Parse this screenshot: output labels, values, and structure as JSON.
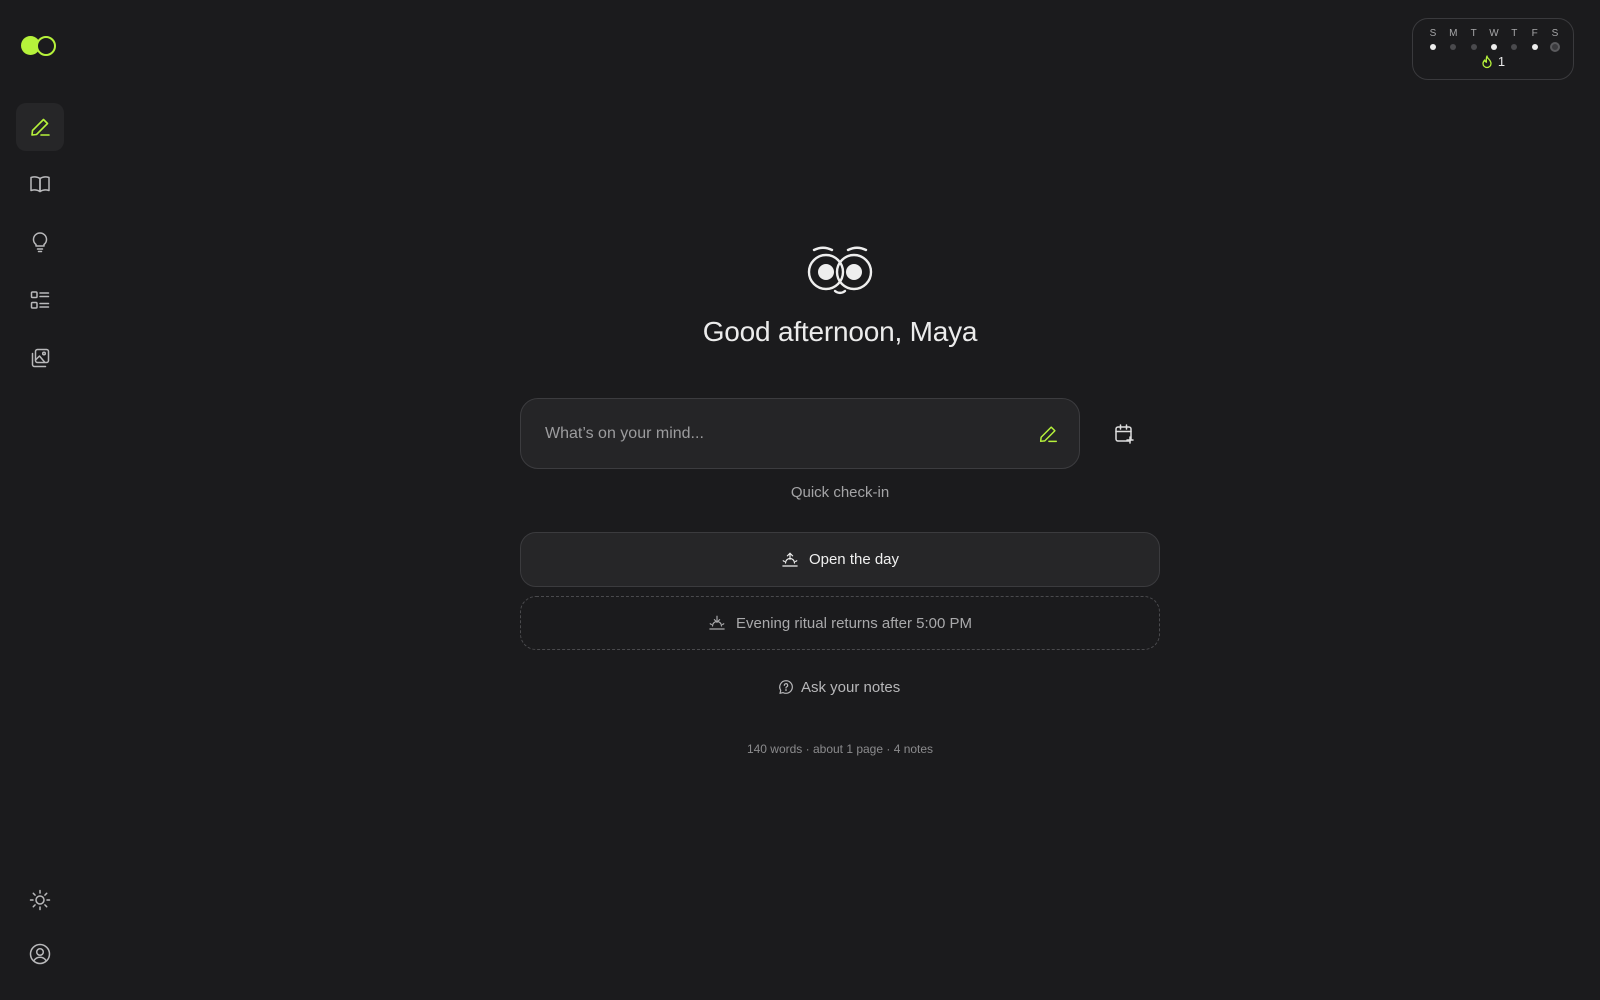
{
  "sidebar": {
    "items": [
      {
        "icon": "pencil-icon",
        "active": true
      },
      {
        "icon": "book-icon",
        "active": false
      },
      {
        "icon": "lightbulb-icon",
        "active": false
      },
      {
        "icon": "list-icon",
        "active": false
      },
      {
        "icon": "gallery-icon",
        "active": false
      }
    ],
    "bottom_items": [
      {
        "icon": "sun-icon"
      },
      {
        "icon": "user-circle-icon"
      }
    ]
  },
  "streak": {
    "days": [
      {
        "letter": "S",
        "state": "done"
      },
      {
        "letter": "M",
        "state": "missed"
      },
      {
        "letter": "T",
        "state": "missed"
      },
      {
        "letter": "W",
        "state": "done"
      },
      {
        "letter": "T",
        "state": "missed"
      },
      {
        "letter": "F",
        "state": "done"
      },
      {
        "letter": "S",
        "state": "today"
      }
    ],
    "count": "1",
    "icon": "flame-icon"
  },
  "main": {
    "mascot_icon": "owl-icon",
    "greeting": "Good afternoon, Maya",
    "input_placeholder": "What’s on your mind...",
    "quick_checkin": "Quick check-in",
    "open_day": "Open the day",
    "evening": "Evening ritual returns after 5:00 PM",
    "ask_notes": "Ask your notes",
    "stats": "140 words · about 1 page · 4 notes"
  },
  "colors": {
    "accent": "#b6f23b",
    "background": "#1b1b1d"
  }
}
